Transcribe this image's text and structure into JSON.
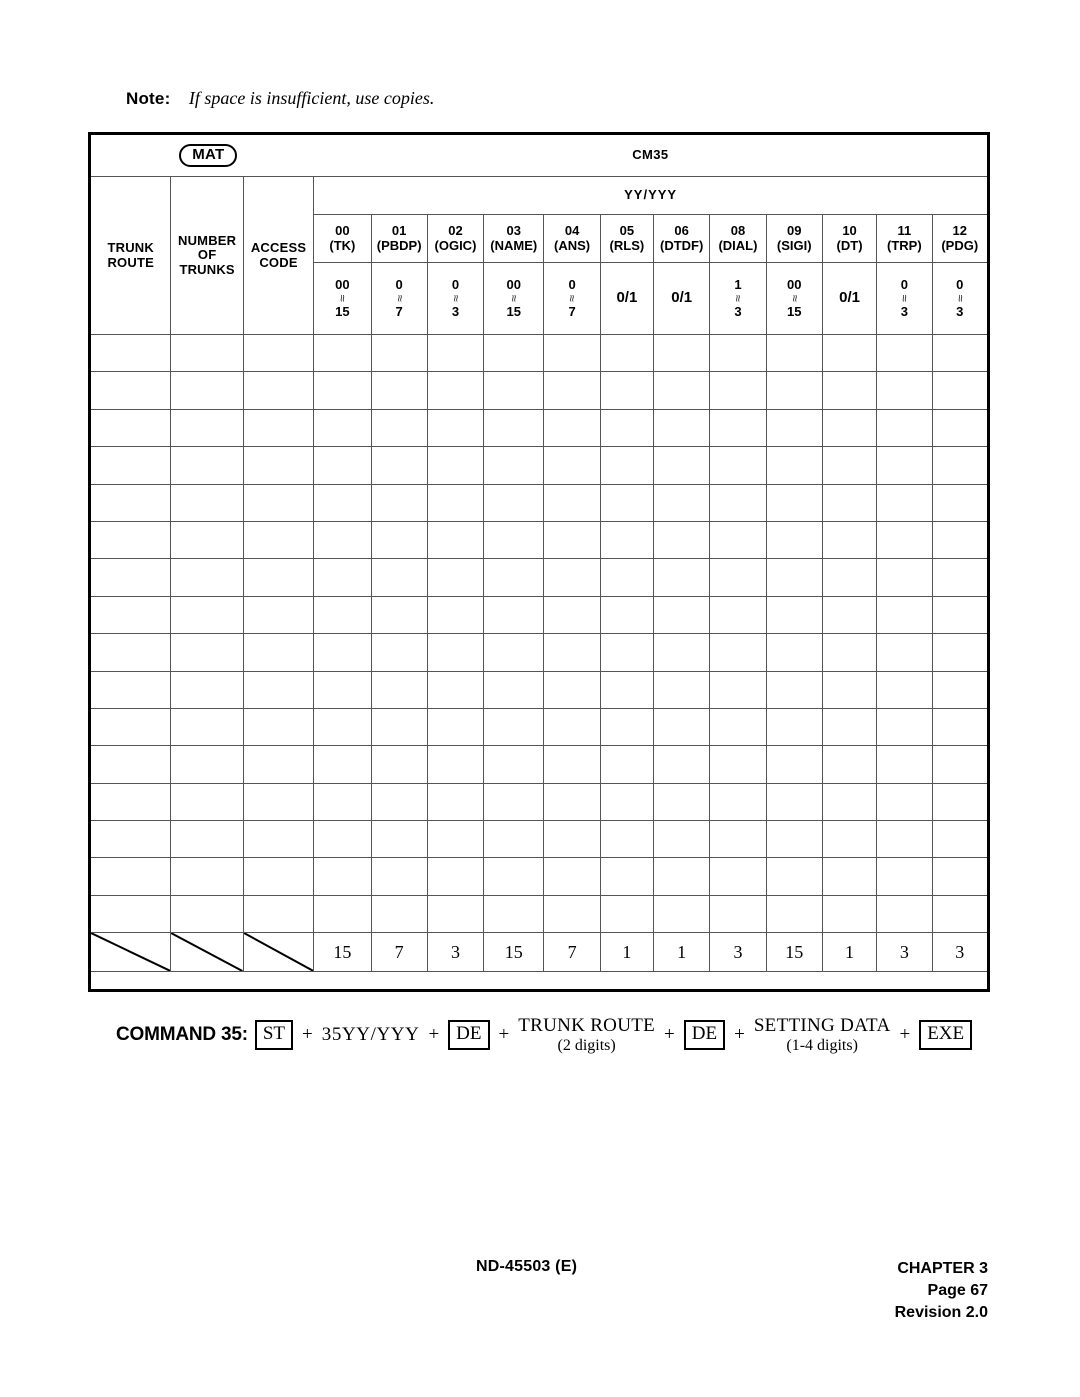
{
  "note": {
    "label": "Note:",
    "text": "If space is insufficient, use copies."
  },
  "table": {
    "mat_badge": "MAT",
    "command_title": "CM35",
    "group_header": "YY/YYY",
    "left_headers": [
      {
        "name": "trunk-route",
        "lines": [
          "TRUNK",
          "ROUTE"
        ]
      },
      {
        "name": "number-of-trunks",
        "lines": [
          "NUMBER",
          "OF",
          "TRUNKS"
        ]
      },
      {
        "name": "access-code",
        "lines": [
          "ACCESS",
          "CODE"
        ]
      }
    ],
    "columns": [
      {
        "num": "00",
        "abbr": "(TK)",
        "range_top": "00",
        "range_mid": "≈",
        "range_bot": "15",
        "single": ""
      },
      {
        "num": "01",
        "abbr": "(PBDP)",
        "range_top": "0",
        "range_mid": "≈",
        "range_bot": "7",
        "single": ""
      },
      {
        "num": "02",
        "abbr": "(OGIC)",
        "range_top": "0",
        "range_mid": "≈",
        "range_bot": "3",
        "single": ""
      },
      {
        "num": "03",
        "abbr": "(NAME)",
        "range_top": "00",
        "range_mid": "≈",
        "range_bot": "15",
        "single": ""
      },
      {
        "num": "04",
        "abbr": "(ANS)",
        "range_top": "0",
        "range_mid": "≈",
        "range_bot": "7",
        "single": ""
      },
      {
        "num": "05",
        "abbr": "(RLS)",
        "range_top": "",
        "range_mid": "",
        "range_bot": "",
        "single": "0/1"
      },
      {
        "num": "06",
        "abbr": "(DTDF)",
        "range_top": "",
        "range_mid": "",
        "range_bot": "",
        "single": "0/1"
      },
      {
        "num": "08",
        "abbr": "(DIAL)",
        "range_top": "1",
        "range_mid": "≈",
        "range_bot": "3",
        "single": ""
      },
      {
        "num": "09",
        "abbr": "(SIGI)",
        "range_top": "00",
        "range_mid": "≈",
        "range_bot": "15",
        "single": ""
      },
      {
        "num": "10",
        "abbr": "(DT)",
        "range_top": "",
        "range_mid": "",
        "range_bot": "",
        "single": "0/1"
      },
      {
        "num": "11",
        "abbr": "(TRP)",
        "range_top": "0",
        "range_mid": "≈",
        "range_bot": "3",
        "single": ""
      },
      {
        "num": "12",
        "abbr": "(PDG)",
        "range_top": "0",
        "range_mid": "≈",
        "range_bot": "3",
        "single": ""
      }
    ],
    "blank_row_count": 16,
    "last_row_values": [
      "15",
      "7",
      "3",
      "15",
      "7",
      "1",
      "1",
      "3",
      "15",
      "1",
      "3",
      "3"
    ]
  },
  "command": {
    "label": "COMMAND 35:",
    "key_st": "ST",
    "code": "35YY/YYY",
    "key_de_1": "DE",
    "trunk_route_top": "TRUNK ROUTE",
    "trunk_route_bot": "(2 digits)",
    "key_de_2": "DE",
    "setting_data_top": "SETTING DATA",
    "setting_data_bot": "(1-4 digits)",
    "key_exe": "EXE",
    "plus": "+"
  },
  "footer": {
    "doc_id": "ND-45503 (E)",
    "chapter": "CHAPTER 3",
    "page": "Page 67",
    "revision": "Revision 2.0"
  }
}
